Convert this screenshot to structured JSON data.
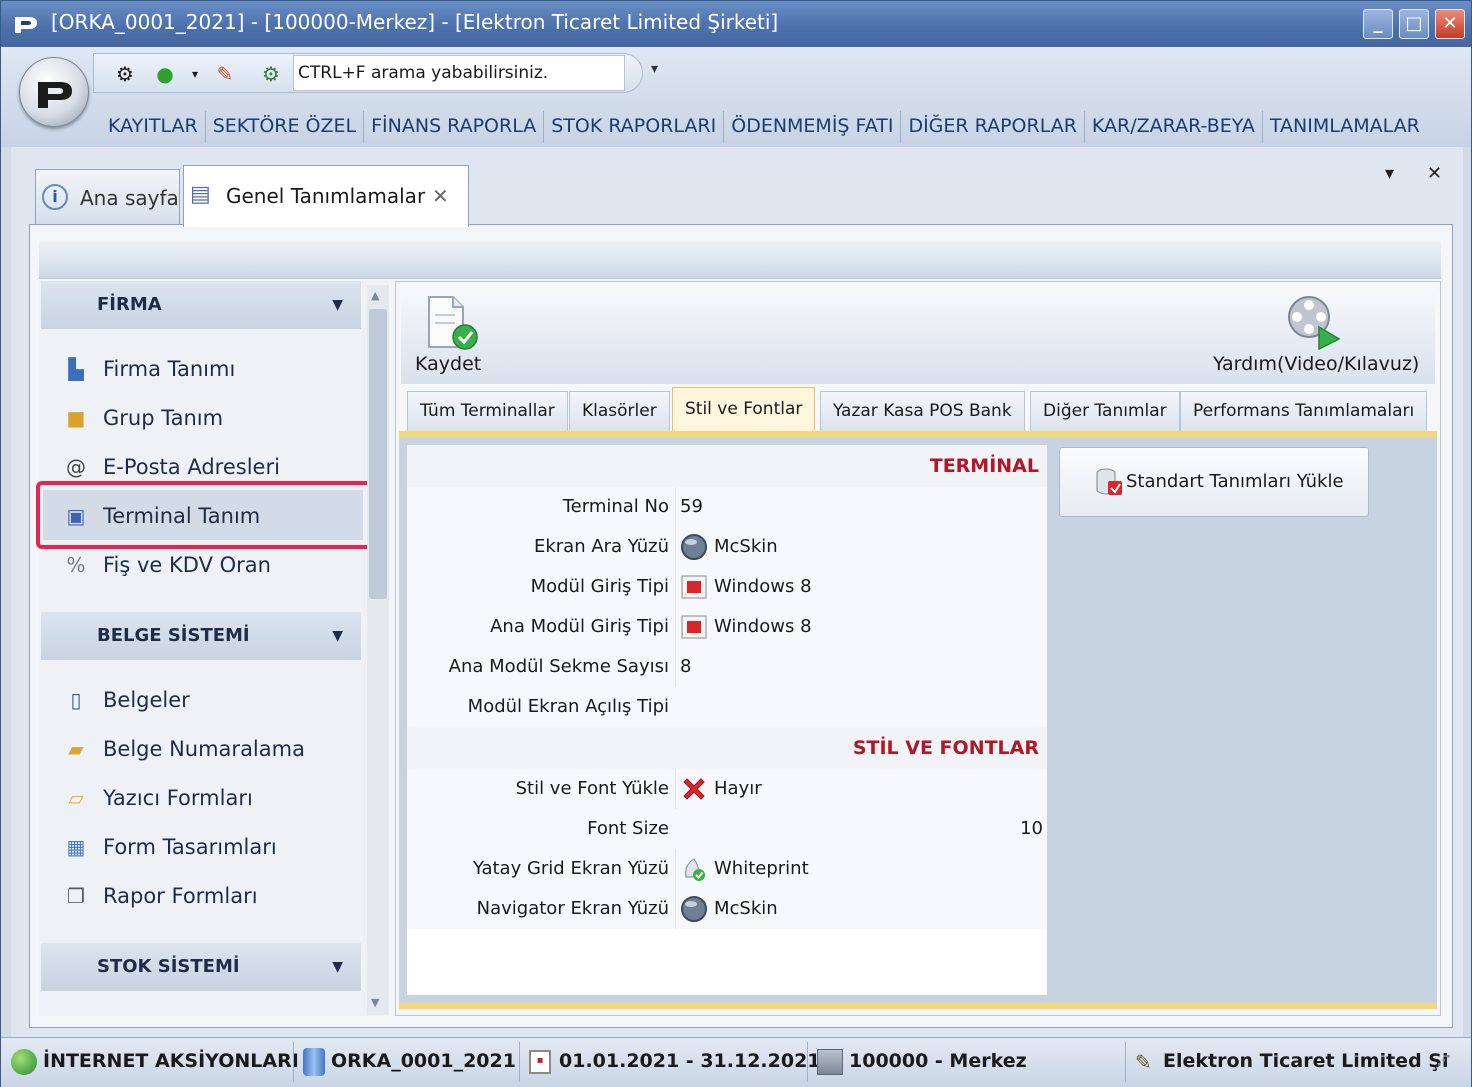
{
  "window": {
    "title": "[ORKA_0001_2021]  -  [100000-Merkez]  -  [Elektron Ticaret Limited Şirketi]"
  },
  "quick_access": {
    "search_placeholder": "CTRL+F arama yababilirsiniz."
  },
  "menu": [
    "KAYITLAR",
    "SEKTÖRE ÖZEL",
    "FİNANS RAPORLA",
    "STOK RAPORLARI",
    "ÖDENMEMİŞ FATI",
    "DİĞER RAPORLAR",
    "KAR/ZARAR-BEYA",
    "TANIMLAMALAR"
  ],
  "doc_tabs": [
    {
      "label": "Ana sayfa"
    },
    {
      "label": "Genel Tanımlamalar",
      "close": "✕"
    }
  ],
  "sidebar": {
    "groups": [
      {
        "title": "FİRMA",
        "items": [
          "Firma Tanımı",
          "Grup Tanım",
          "E-Posta Adresleri",
          "Terminal Tanım",
          "Fiş ve KDV Oran"
        ]
      },
      {
        "title": "BELGE SİSTEMİ",
        "items": [
          "Belgeler",
          "Belge Numaralama",
          "Yazıcı Formları",
          "Form Tasarımları",
          "Rapor Formları"
        ]
      },
      {
        "title": "STOK SİSTEMİ",
        "items": []
      }
    ],
    "selected": "Terminal Tanım"
  },
  "toolbar": {
    "save_label": "Kaydet",
    "help_label": "Yardım(Video/Kılavuz)"
  },
  "sub_tabs": [
    "Tüm Terminallar",
    "Klasörler",
    "Stil ve Fontlar",
    "Yazar Kasa POS Bank",
    "Diğer Tanımlar",
    "Performans Tanımlamaları"
  ],
  "active_sub_tab": "Stil ve Fontlar",
  "properties": {
    "terminal_section": "TERMİNAL",
    "terminal_rows": [
      {
        "label": "Terminal No",
        "value": "59"
      },
      {
        "label": "Ekran Ara Yüzü",
        "value": "McSkin",
        "icon": "skin-icon"
      },
      {
        "label": "Modül Giriş Tipi",
        "value": "Windows 8",
        "icon": "window-icon"
      },
      {
        "label": "Ana Modül Giriş Tipi",
        "value": "Windows 8",
        "icon": "window-icon"
      },
      {
        "label": "Ana Modül Sekme Sayısı",
        "value": "8"
      },
      {
        "label": "Modül Ekran Açılış Tipi",
        "value": ""
      }
    ],
    "style_section": "STİL VE FONTLAR",
    "style_rows": [
      {
        "label": "Stil ve Font Yükle",
        "value": "Hayır",
        "icon": "red-x-icon"
      },
      {
        "label": "Font Size",
        "value": "10"
      },
      {
        "label": "Yatay Grid Ekran Yüzü",
        "value": "Whiteprint",
        "icon": "whiteprint-icon"
      },
      {
        "label": "Navigator Ekran Yüzü",
        "value": "McSkin",
        "icon": "skin-icon"
      }
    ]
  },
  "standard_button": "Standart Tanımları Yükle",
  "statusbar": {
    "internet": "İNTERNET AKSİYONLARI",
    "database": "ORKA_0001_2021",
    "period": "01.01.2021 - 31.12.2021",
    "branch": "100000 - Merkez",
    "company": "Elektron Ticaret Limited Şi"
  },
  "colors": {
    "title_bar": "#4d71ab",
    "highlight": "#e8234f",
    "section_title": "#b0182a",
    "active_tab": "#f2d774"
  }
}
